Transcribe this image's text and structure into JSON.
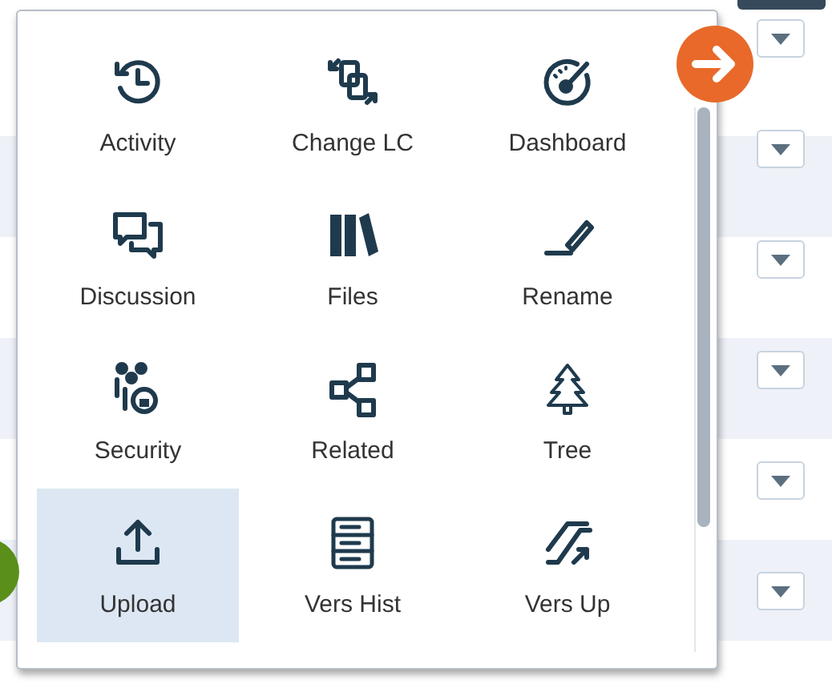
{
  "menu": {
    "items": [
      {
        "label": "Activity",
        "selected": false
      },
      {
        "label": "Change LC",
        "selected": false
      },
      {
        "label": "Dashboard",
        "selected": false
      },
      {
        "label": "Discussion",
        "selected": false
      },
      {
        "label": "Files",
        "selected": false
      },
      {
        "label": "Rename",
        "selected": false
      },
      {
        "label": "Security",
        "selected": false
      },
      {
        "label": "Related",
        "selected": false
      },
      {
        "label": "Tree",
        "selected": false
      },
      {
        "label": "Upload",
        "selected": true
      },
      {
        "label": "Vers Hist",
        "selected": false
      },
      {
        "label": "Vers Up",
        "selected": false
      }
    ]
  }
}
